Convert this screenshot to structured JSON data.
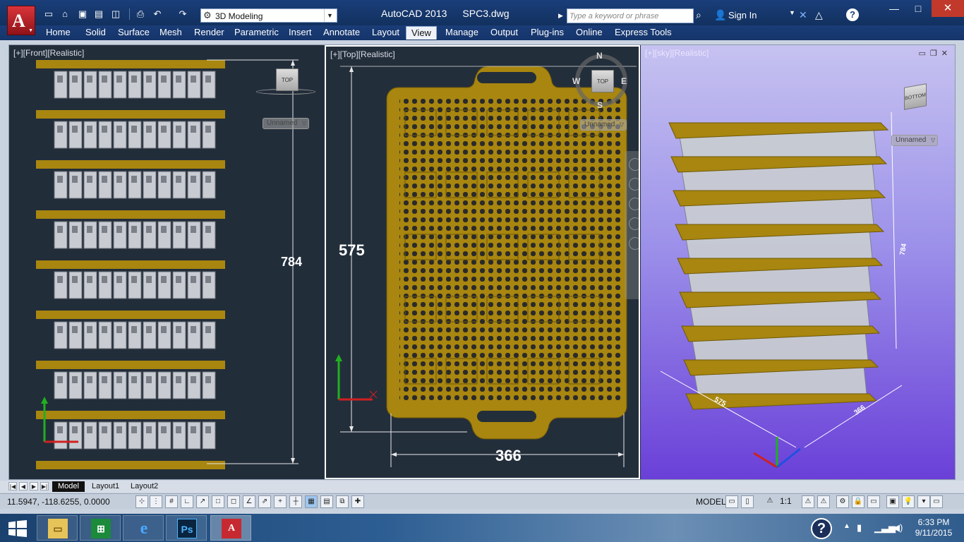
{
  "app": {
    "name": "AutoCAD 2013",
    "file": "SPC3.dwg",
    "workspace": "3D Modeling",
    "search_placeholder": "Type a keyword or phrase",
    "sign_in": "Sign In"
  },
  "ribbon": {
    "tabs": [
      "Home",
      "Solid",
      "Surface",
      "Mesh",
      "Render",
      "Parametric",
      "Insert",
      "Annotate",
      "Layout",
      "View",
      "Manage",
      "Output",
      "Plug-ins",
      "Online",
      "Express Tools"
    ],
    "active_tab": "View"
  },
  "viewports": {
    "front": {
      "label": "[+][Front][Realistic]",
      "viewcube": "TOP",
      "named_view": "Unnamed",
      "dimension": "784"
    },
    "top": {
      "label": "[+][Top][Realistic]",
      "viewcube": "TOP",
      "named_view": "Unnamed",
      "compass": {
        "n": "N",
        "s": "S",
        "e": "E",
        "w": "W"
      },
      "dim_height": "575",
      "dim_width": "366"
    },
    "sky": {
      "label": "[+][sky][Realistic]",
      "viewcube": "BOTTOM",
      "named_view": "Unnamed",
      "dim_height": "784",
      "dim_length": "575",
      "dim_width": "366"
    }
  },
  "layout_tabs": {
    "model": "Model",
    "layout1": "Layout1",
    "layout2": "Layout2"
  },
  "status": {
    "coordinates": "11.5947, -118.6255, 0.0000",
    "model": "MODEL",
    "annotation_scale": "1:1"
  },
  "taskbar": {
    "time": "6:33 PM",
    "date": "9/11/2015",
    "apps": [
      "file-explorer",
      "windows-store",
      "internet-explorer",
      "photoshop",
      "autocad"
    ],
    "help": "?"
  },
  "colors": {
    "tray_gold": "#a8860f",
    "part_gray": "#c8ccd2",
    "sky_purple": "#6a40d8",
    "x_axis": "#d02020",
    "y_axis": "#20b020",
    "z_axis": "#2050e0"
  }
}
